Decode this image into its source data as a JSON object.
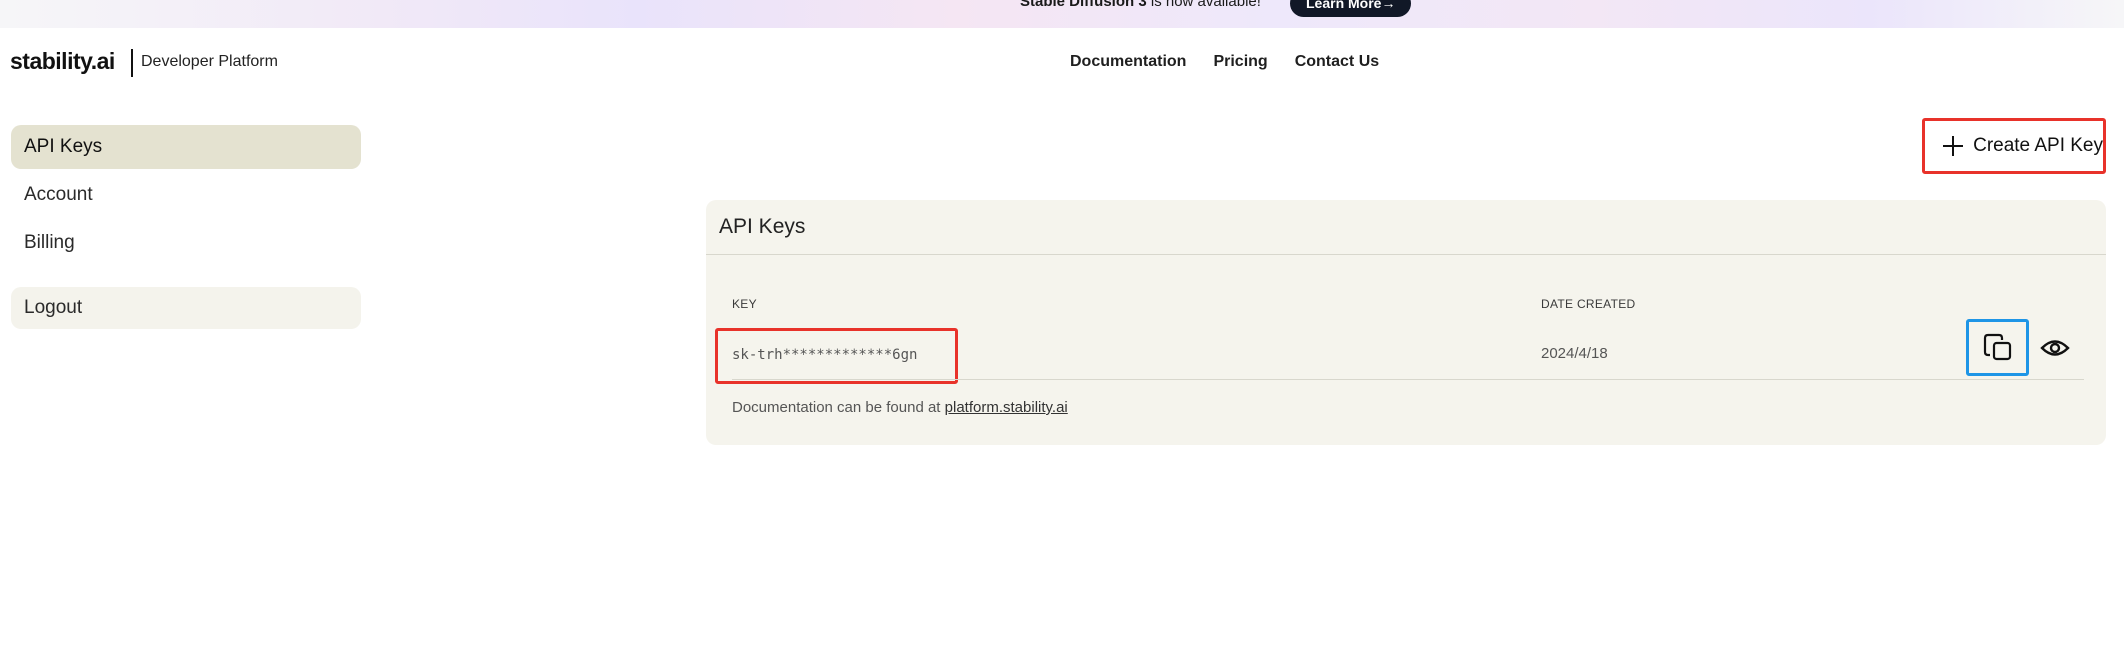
{
  "banner": {
    "highlight": "Stable Diffusion 3",
    "text": "is now available!",
    "button_label": "Learn More→"
  },
  "header": {
    "logo": "stability.ai",
    "platform_label": "Developer Platform",
    "nav": [
      "Documentation",
      "Pricing",
      "Contact Us"
    ]
  },
  "sidebar": {
    "items": [
      {
        "label": "API Keys",
        "active": true
      },
      {
        "label": "Account",
        "active": false
      },
      {
        "label": "Billing",
        "active": false
      }
    ],
    "logout_label": "Logout"
  },
  "main": {
    "create_button_label": "Create API Key",
    "card_title": "API Keys",
    "columns": {
      "key": "KEY",
      "date": "DATE CREATED"
    },
    "rows": [
      {
        "key": "sk-trh*************6gn",
        "date": "2024/4/18"
      }
    ],
    "doc_note_prefix": "Documentation can be found at",
    "doc_link": "platform.stability.ai"
  },
  "icons": {
    "create": "plus-icon",
    "copy": "copy-icon",
    "reveal": "eye-icon"
  },
  "colors": {
    "active_item_bg": "#e4e2d0",
    "card_bg": "#f5f4ed",
    "highlight_red": "#e8322a",
    "highlight_blue": "#1e95e6",
    "banner_button_bg": "#111827"
  }
}
